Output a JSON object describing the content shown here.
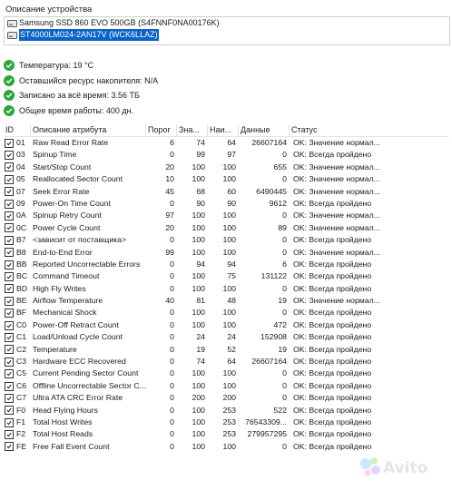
{
  "section_title": "Описание устройства",
  "devices": [
    {
      "label": "Samsung SSD 860 EVO 500GB (S4FNNF0NA00176K)",
      "selected": false
    },
    {
      "label": "ST4000LM024-2AN17V (WCK6LLAZ)",
      "selected": true
    }
  ],
  "metrics": [
    {
      "label": "Температура: 19 °C"
    },
    {
      "label": "Оставшийся ресурс накопителя: N/A"
    },
    {
      "label": "Записано за всё время: 3.56 ТБ"
    },
    {
      "label": "Общее время работы: 400 дн."
    }
  ],
  "columns": {
    "id": "ID",
    "name": "Описание атрибута",
    "threshold": "Порог",
    "value": "Зна...",
    "worst": "Наи...",
    "data": "Данные",
    "status": "Статус"
  },
  "rows": [
    {
      "id": "01",
      "name": "Raw Read Error Rate",
      "threshold": "6",
      "value": "74",
      "worst": "64",
      "data": "26607164",
      "status": "OK: Значение нормал..."
    },
    {
      "id": "03",
      "name": "Spinup Time",
      "threshold": "0",
      "value": "99",
      "worst": "97",
      "data": "0",
      "status": "OK: Всегда пройдено"
    },
    {
      "id": "04",
      "name": "Start/Stop Count",
      "threshold": "20",
      "value": "100",
      "worst": "100",
      "data": "655",
      "status": "OK: Значение нормал..."
    },
    {
      "id": "05",
      "name": "Reallocated Sector Count",
      "threshold": "10",
      "value": "100",
      "worst": "100",
      "data": "0",
      "status": "OK: Значение нормал..."
    },
    {
      "id": "07",
      "name": "Seek Error Rate",
      "threshold": "45",
      "value": "68",
      "worst": "60",
      "data": "6490445",
      "status": "OK: Значение нормал..."
    },
    {
      "id": "09",
      "name": "Power-On Time Count",
      "threshold": "0",
      "value": "90",
      "worst": "90",
      "data": "9612",
      "status": "OK: Всегда пройдено"
    },
    {
      "id": "0A",
      "name": "Spinup Retry Count",
      "threshold": "97",
      "value": "100",
      "worst": "100",
      "data": "0",
      "status": "OK: Значение нормал..."
    },
    {
      "id": "0C",
      "name": "Power Cycle Count",
      "threshold": "20",
      "value": "100",
      "worst": "100",
      "data": "89",
      "status": "OK: Значение нормал..."
    },
    {
      "id": "B7",
      "name": "<зависит от поставщика>",
      "threshold": "0",
      "value": "100",
      "worst": "100",
      "data": "0",
      "status": "OK: Всегда пройдено"
    },
    {
      "id": "B8",
      "name": "End-to-End Error",
      "threshold": "99",
      "value": "100",
      "worst": "100",
      "data": "0",
      "status": "OK: Значение нормал..."
    },
    {
      "id": "BB",
      "name": "Reported Uncorrectable Errors",
      "threshold": "0",
      "value": "94",
      "worst": "94",
      "data": "6",
      "status": "OK: Всегда пройдено"
    },
    {
      "id": "BC",
      "name": "Command Timeout",
      "threshold": "0",
      "value": "100",
      "worst": "75",
      "data": "131122",
      "status": "OK: Всегда пройдено"
    },
    {
      "id": "BD",
      "name": "High Fly Writes",
      "threshold": "0",
      "value": "100",
      "worst": "100",
      "data": "0",
      "status": "OK: Всегда пройдено"
    },
    {
      "id": "BE",
      "name": "Airflow Temperature",
      "threshold": "40",
      "value": "81",
      "worst": "48",
      "data": "19",
      "status": "OK: Значение нормал..."
    },
    {
      "id": "BF",
      "name": "Mechanical Shock",
      "threshold": "0",
      "value": "100",
      "worst": "100",
      "data": "0",
      "status": "OK: Всегда пройдено"
    },
    {
      "id": "C0",
      "name": "Power-Off Retract Count",
      "threshold": "0",
      "value": "100",
      "worst": "100",
      "data": "472",
      "status": "OK: Всегда пройдено"
    },
    {
      "id": "C1",
      "name": "Load/Unload Cycle Count",
      "threshold": "0",
      "value": "24",
      "worst": "24",
      "data": "152908",
      "status": "OK: Всегда пройдено"
    },
    {
      "id": "C2",
      "name": "Temperature",
      "threshold": "0",
      "value": "19",
      "worst": "52",
      "data": "19",
      "status": "OK: Всегда пройдено"
    },
    {
      "id": "C3",
      "name": "Hardware ECC Recovered",
      "threshold": "0",
      "value": "74",
      "worst": "64",
      "data": "26607164",
      "status": "OK: Всегда пройдено"
    },
    {
      "id": "C5",
      "name": "Current Pending Sector Count",
      "threshold": "0",
      "value": "100",
      "worst": "100",
      "data": "0",
      "status": "OK: Всегда пройдено"
    },
    {
      "id": "C6",
      "name": "Offline Uncorrectable Sector C...",
      "threshold": "0",
      "value": "100",
      "worst": "100",
      "data": "0",
      "status": "OK: Всегда пройдено"
    },
    {
      "id": "C7",
      "name": "Ultra ATA CRC Error Rate",
      "threshold": "0",
      "value": "200",
      "worst": "200",
      "data": "0",
      "status": "OK: Всегда пройдено"
    },
    {
      "id": "F0",
      "name": "Head Flying Hours",
      "threshold": "0",
      "value": "100",
      "worst": "253",
      "data": "522",
      "status": "OK: Всегда пройдено"
    },
    {
      "id": "F1",
      "name": "Total Host Writes",
      "threshold": "0",
      "value": "100",
      "worst": "253",
      "data": "76543309...",
      "status": "OK: Всегда пройдено"
    },
    {
      "id": "F2",
      "name": "Total Host Reads",
      "threshold": "0",
      "value": "100",
      "worst": "253",
      "data": "279957295",
      "status": "OK: Всегда пройдено"
    },
    {
      "id": "FE",
      "name": "Free Fall Event Count",
      "threshold": "0",
      "value": "100",
      "worst": "100",
      "data": "0",
      "status": "OK: Всегда пройдено"
    }
  ]
}
